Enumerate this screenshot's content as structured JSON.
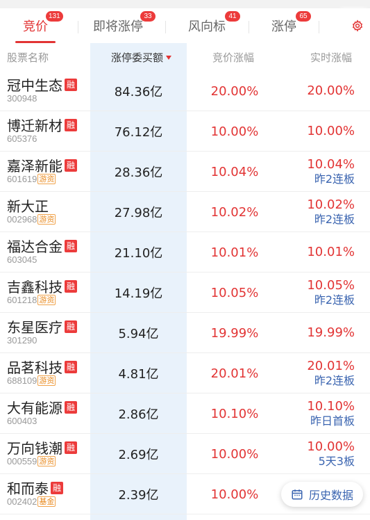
{
  "tabs": [
    {
      "label": "竞价",
      "badge": "131",
      "active": true
    },
    {
      "label": "即将涨停",
      "badge": "33",
      "active": false
    },
    {
      "label": "风向标",
      "badge": "41",
      "active": false
    },
    {
      "label": "涨停",
      "badge": "65",
      "active": false
    }
  ],
  "columns": {
    "name": "股票名称",
    "amount": "涨停委买额",
    "bid_change": "竞价涨幅",
    "realtime_change": "实时涨幅"
  },
  "rows": [
    {
      "name": "冠中生态",
      "code": "300948",
      "rong": "融",
      "tag": "",
      "amount": "84.36亿",
      "bid": "20.00%",
      "rt": "20.00%",
      "board": ""
    },
    {
      "name": "博迁新材",
      "code": "605376",
      "rong": "融",
      "tag": "",
      "amount": "76.12亿",
      "bid": "10.00%",
      "rt": "10.00%",
      "board": ""
    },
    {
      "name": "嘉泽新能",
      "code": "601619",
      "rong": "融",
      "tag": "游资",
      "amount": "28.36亿",
      "bid": "10.04%",
      "rt": "10.04%",
      "board": "昨2连板"
    },
    {
      "name": "新大正",
      "code": "002968",
      "rong": "",
      "tag": "游资",
      "amount": "27.98亿",
      "bid": "10.02%",
      "rt": "10.02%",
      "board": "昨2连板"
    },
    {
      "name": "福达合金",
      "code": "603045",
      "rong": "融",
      "tag": "",
      "amount": "21.10亿",
      "bid": "10.01%",
      "rt": "10.01%",
      "board": ""
    },
    {
      "name": "吉鑫科技",
      "code": "601218",
      "rong": "融",
      "tag": "游资",
      "amount": "14.19亿",
      "bid": "10.05%",
      "rt": "10.05%",
      "board": "昨2连板"
    },
    {
      "name": "东星医疗",
      "code": "301290",
      "rong": "融",
      "tag": "",
      "amount": "5.94亿",
      "bid": "19.99%",
      "rt": "19.99%",
      "board": ""
    },
    {
      "name": "品茗科技",
      "code": "688109",
      "rong": "融",
      "tag": "游资",
      "amount": "4.81亿",
      "bid": "20.01%",
      "rt": "20.01%",
      "board": "昨2连板"
    },
    {
      "name": "大有能源",
      "code": "600403",
      "rong": "融",
      "tag": "",
      "amount": "2.86亿",
      "bid": "10.10%",
      "rt": "10.10%",
      "board": "昨日首板"
    },
    {
      "name": "万向钱潮",
      "code": "000559",
      "rong": "融",
      "tag": "游资",
      "amount": "2.69亿",
      "bid": "10.00%",
      "rt": "10.00%",
      "board": "5天3板"
    },
    {
      "name": "和而泰",
      "code": "002402",
      "rong": "融",
      "tag": "基金",
      "amount": "2.39亿",
      "bid": "10.00%",
      "rt": "",
      "board": ""
    }
  ],
  "history_button": "历史数据",
  "icons": {
    "settings": "gear-icon",
    "calendar": "calendar-icon",
    "sort": "sort-desc-icon"
  },
  "colors": {
    "up": "#e23434",
    "board": "#3a64b0",
    "highlight": "#e9f2fb",
    "tag": "#e98a1f"
  }
}
